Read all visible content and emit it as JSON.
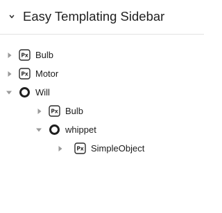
{
  "sidebar": {
    "title": "Easy Templating Sidebar",
    "toggle_icon": "chevron-down-icon"
  },
  "tree": {
    "items": [
      {
        "label": "Bulb",
        "icon": "component-px-icon",
        "state": "collapsed",
        "depth": 0
      },
      {
        "label": "Motor",
        "icon": "component-px-icon",
        "state": "collapsed",
        "depth": 0
      },
      {
        "label": "Will",
        "icon": "folder-ring-icon",
        "state": "expanded",
        "depth": 0
      },
      {
        "label": "Bulb",
        "icon": "component-px-icon",
        "state": "collapsed",
        "depth": 1
      },
      {
        "label": "whippet",
        "icon": "folder-ring-icon",
        "state": "expanded",
        "depth": 1
      },
      {
        "label": "SimpleObject",
        "icon": "component-px-icon",
        "state": "collapsed",
        "depth": 2
      }
    ]
  },
  "colors": {
    "toggle_arrow": "#9a9a9a",
    "icon_stroke": "#2a2a2a",
    "text": "#1a1a1a"
  }
}
